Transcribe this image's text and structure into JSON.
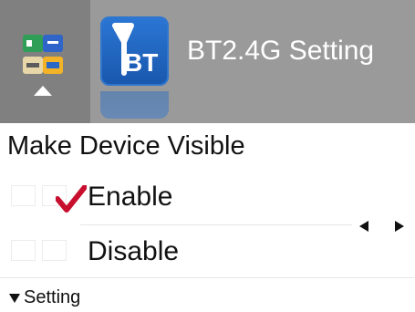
{
  "header": {
    "title": "BT2.4G Setting",
    "nav_icon": "connection-apps-icon",
    "app_icon": "bluetooth-antenna-icon",
    "app_icon_text": "BT",
    "accent_color": "#1f66c1",
    "background_color": "#9a9a9a"
  },
  "main": {
    "section_label": "Make Device Visible",
    "options": [
      {
        "label": "Enable",
        "selected": true,
        "check_color": "#c8102e"
      },
      {
        "label": "Disable",
        "selected": false
      }
    ],
    "navigation": {
      "left_icon": "arrow-left-icon",
      "right_icon": "arrow-right-icon"
    }
  },
  "footer": {
    "label": "Setting",
    "icon": "triangle-down-icon"
  }
}
